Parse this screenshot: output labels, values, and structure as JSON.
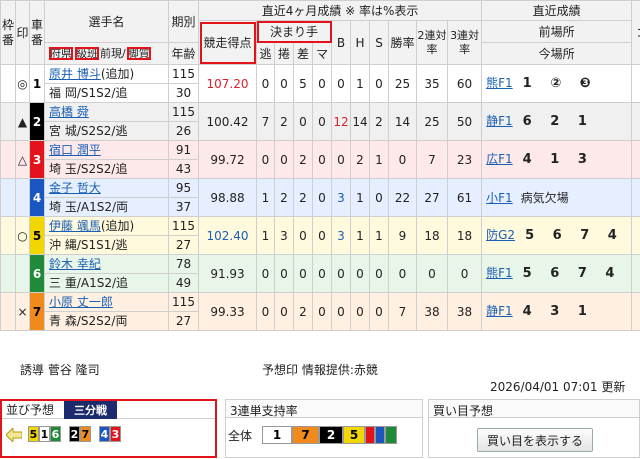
{
  "headers": {
    "frame": "枠番",
    "mark": "印",
    "car": "車番",
    "rider": "選手名",
    "pref": "府県",
    "class": "級班",
    "prev_class": "前現",
    "style": "脚質",
    "term": "期別",
    "age": "年齢",
    "recent_title": "直近4ヶ月成績 ※ 率は%表示",
    "score": "競走得点",
    "kimarite": "決まり手",
    "nige": "逃",
    "makuri": "捲",
    "sashi": "差",
    "mark_k": "マ",
    "b": "B",
    "h": "H",
    "s": "S",
    "win": "勝率",
    "rate2": "2連対率",
    "rate3": "3連対率",
    "results": "直近成績",
    "prev_venue": "前場所",
    "curr_venue": "今場所",
    "extra": "コ"
  },
  "riders": [
    {
      "mark": "◎",
      "car": "1",
      "name": "原井 博斗",
      "note": "(追加)",
      "pref": "福 岡",
      "cls": "S1S2",
      "style": "追",
      "term": "115",
      "age": "30",
      "score": "107.20",
      "score_color": "#d8232a",
      "nige": "0",
      "makuri": "0",
      "sashi": "5",
      "mk": "0",
      "b": "0",
      "h": "1",
      "s": "0",
      "win": "25",
      "r2": "35",
      "r3": "60",
      "venue": "熊F1",
      "ranks": "1 ② ❸"
    },
    {
      "mark": "▲",
      "car": "2",
      "name": "高橋 舜",
      "note": "",
      "pref": "宮 城",
      "cls": "S2S2",
      "style": "逃",
      "term": "115",
      "age": "26",
      "score": "100.42",
      "score_color": "#222",
      "nige": "7",
      "makuri": "2",
      "sashi": "0",
      "mk": "0",
      "b": "12",
      "h": "14",
      "s": "2",
      "win": "14",
      "r2": "25",
      "r3": "50",
      "venue": "静F1",
      "ranks": "6 2 1"
    },
    {
      "mark": "△",
      "car": "3",
      "name": "宿口 潤平",
      "note": "",
      "pref": "埼 玉",
      "cls": "S2S2",
      "style": "追",
      "term": "91",
      "age": "43",
      "score": "99.72",
      "score_color": "#222",
      "nige": "0",
      "makuri": "0",
      "sashi": "2",
      "mk": "0",
      "b": "0",
      "h": "2",
      "s": "1",
      "win": "0",
      "r2": "7",
      "r3": "23",
      "venue": "広F1",
      "ranks": "4 1 3"
    },
    {
      "mark": "",
      "car": "4",
      "name": "金子 哲大",
      "note": "",
      "pref": "埼 玉",
      "cls": "A1S2",
      "style": "両",
      "term": "95",
      "age": "37",
      "score": "98.88",
      "score_color": "#222",
      "nige": "1",
      "makuri": "2",
      "sashi": "2",
      "mk": "0",
      "b": "3",
      "h": "1",
      "s": "0",
      "win": "22",
      "r2": "27",
      "r3": "61",
      "venue": "小F1",
      "ranks": "病気欠場"
    },
    {
      "mark": "○",
      "car": "5",
      "name": "伊藤 颯馬",
      "note": "(追加)",
      "pref": "沖 縄",
      "cls": "S1S1",
      "style": "逃",
      "term": "115",
      "age": "27",
      "score": "102.40",
      "score_color": "#1a5fb4",
      "nige": "1",
      "makuri": "3",
      "sashi": "0",
      "mk": "0",
      "b": "3",
      "h": "1",
      "s": "1",
      "win": "9",
      "r2": "18",
      "r3": "18",
      "venue": "防G2",
      "ranks": "5 6 7 4"
    },
    {
      "mark": "",
      "car": "6",
      "name": "鈴木 幸紀",
      "note": "",
      "pref": "三 重",
      "cls": "A1S2",
      "style": "追",
      "term": "78",
      "age": "49",
      "score": "91.93",
      "score_color": "#222",
      "nige": "0",
      "makuri": "0",
      "sashi": "0",
      "mk": "0",
      "b": "0",
      "h": "0",
      "s": "0",
      "win": "0",
      "r2": "0",
      "r3": "0",
      "venue": "熊F1",
      "ranks": "5 6 7 4"
    },
    {
      "mark": "×",
      "car": "7",
      "name": "小原 丈一郎",
      "note": "",
      "pref": "青 森",
      "cls": "S2S2",
      "style": "両",
      "term": "115",
      "age": "27",
      "score": "99.33",
      "score_color": "#222",
      "nige": "0",
      "makuri": "0",
      "sashi": "2",
      "mk": "0",
      "b": "0",
      "h": "0",
      "s": "0",
      "win": "7",
      "r2": "38",
      "r3": "38",
      "venue": "静F1",
      "ranks": "4 3 1"
    }
  ],
  "info": {
    "inducer": "誘導 菅谷 隆司",
    "forecast": "予想印 情報提供:赤競",
    "updated": "2026/04/01 07:01 更新"
  },
  "lineup": {
    "title": "並び予想",
    "tag": "三分戦",
    "groups": [
      [
        "5",
        "1",
        "6"
      ],
      [
        "2",
        "7"
      ],
      [
        "4",
        "3"
      ]
    ]
  },
  "support": {
    "title": "3連単支持率",
    "label": "全体",
    "segments": [
      "1",
      "7",
      "2",
      "5"
    ]
  },
  "buy": {
    "title": "買い目予想",
    "button": "買い目を表示する"
  }
}
